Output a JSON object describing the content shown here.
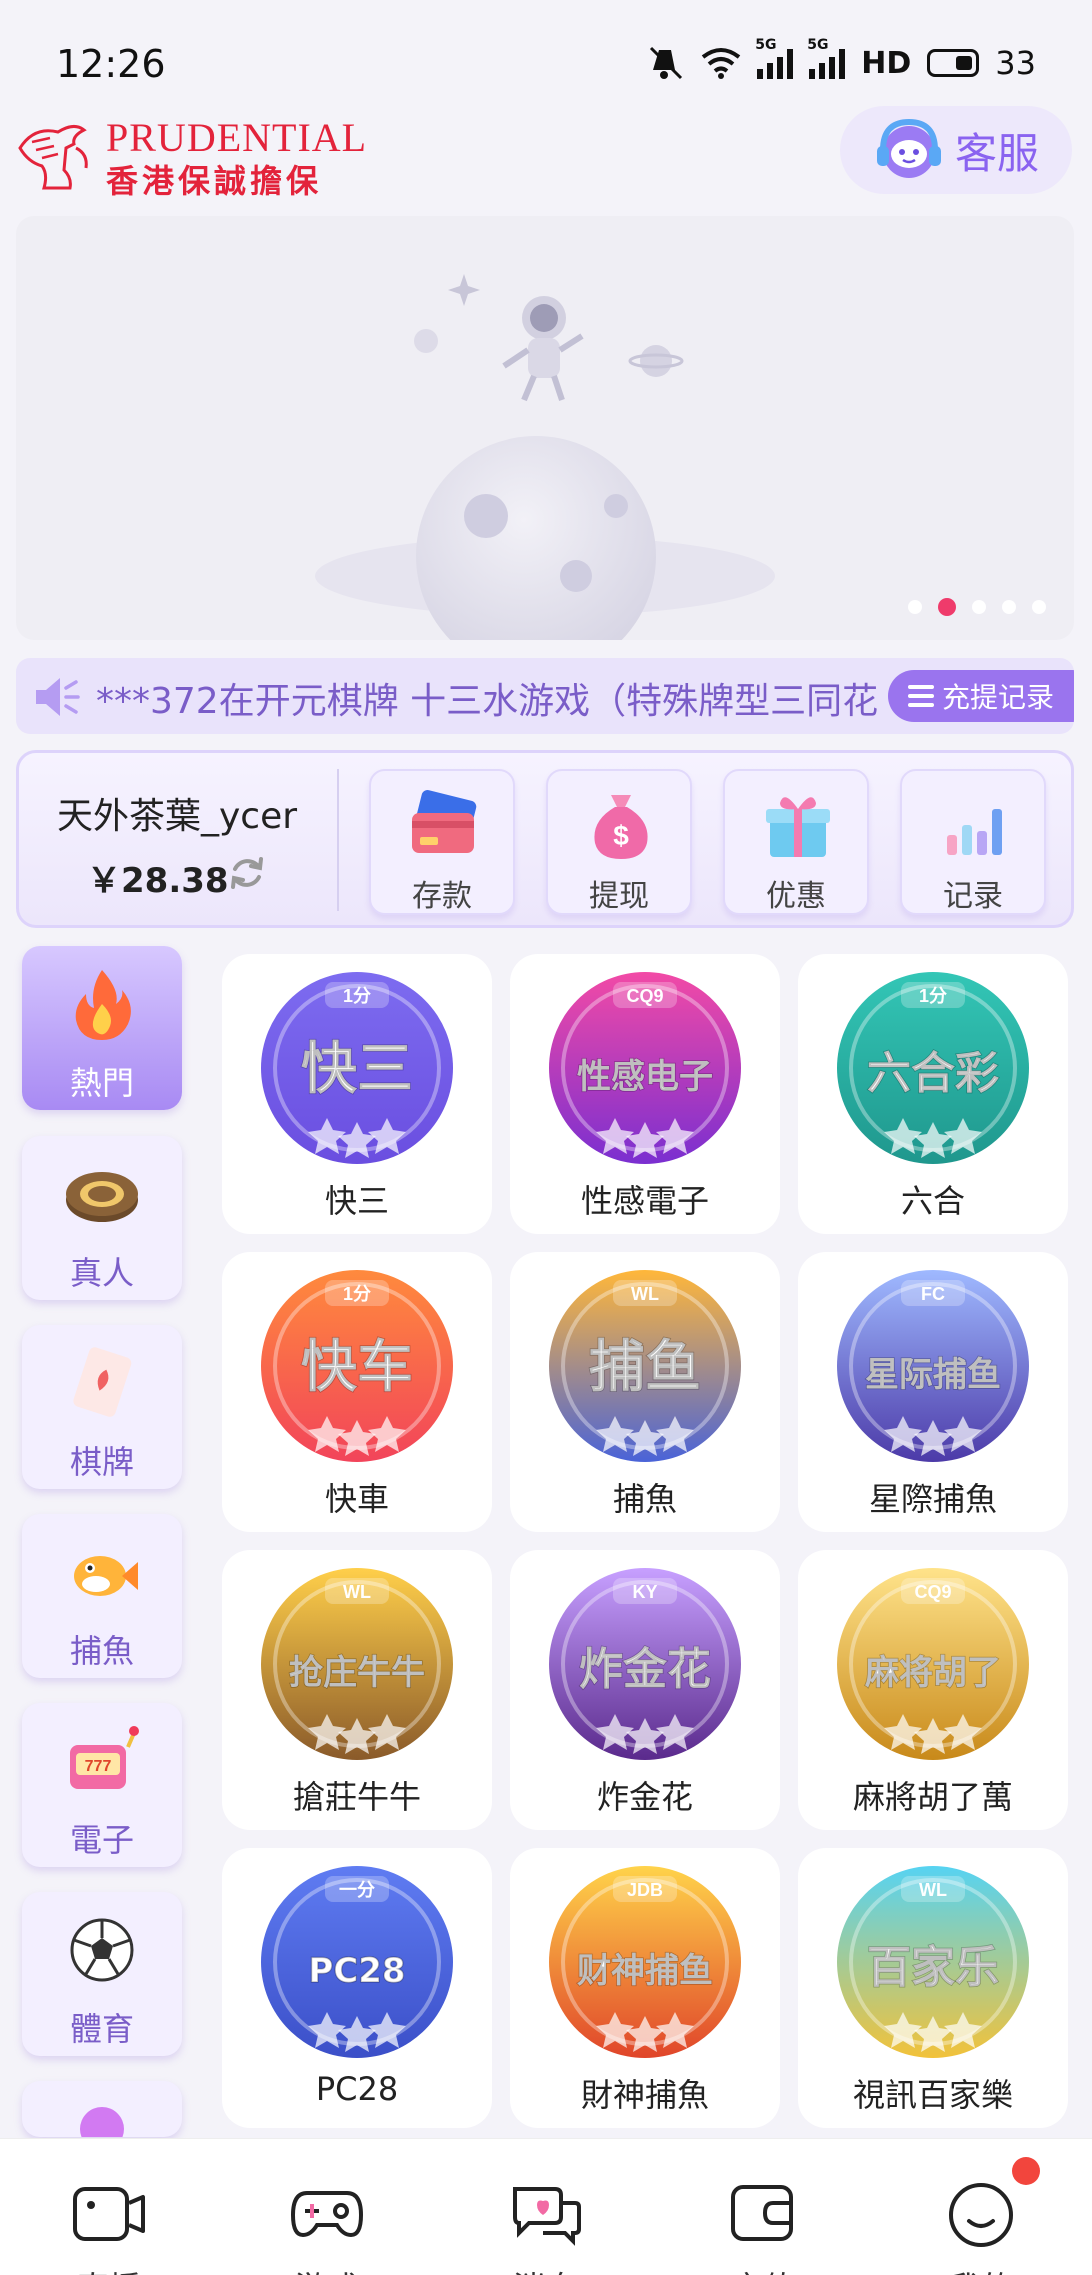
{
  "status": {
    "time": "12:26",
    "hd": "HD",
    "battery": "33",
    "sig_label": "5G"
  },
  "header": {
    "logo_en": "PRUDENTIAL",
    "logo_zh": "香港保誠擔保",
    "service_label": "客服"
  },
  "banner": {
    "dot_count": 5,
    "active_dot": 2
  },
  "marquee": {
    "text": "***372在开元棋牌 十三水游戏（特殊牌型三同花",
    "record_label": "充提记录"
  },
  "wallet": {
    "user_name": "天外茶葉_ycer",
    "balance": "￥28.38",
    "actions": [
      {
        "label": "存款",
        "icon": "card-icon"
      },
      {
        "label": "提现",
        "icon": "money-bag-icon"
      },
      {
        "label": "优惠",
        "icon": "gift-icon"
      },
      {
        "label": "记录",
        "icon": "bar-chart-icon"
      }
    ]
  },
  "categories": [
    {
      "label": "熱門",
      "icon": "flame-icon",
      "active": true
    },
    {
      "label": "真人",
      "icon": "chip-icon",
      "active": false
    },
    {
      "label": "棋牌",
      "icon": "playing-card-icon",
      "active": false
    },
    {
      "label": "捕魚",
      "icon": "fish-icon",
      "active": false
    },
    {
      "label": "電子",
      "icon": "slot-machine-icon",
      "active": false
    },
    {
      "label": "體育",
      "icon": "soccer-ball-icon",
      "active": false
    }
  ],
  "games": [
    {
      "label": "快三",
      "badge": "1分",
      "title": "快三",
      "colors": [
        "#7d6cf0",
        "#6a4ee0"
      ]
    },
    {
      "label": "性感電子",
      "badge": "CQ9",
      "title": "性感电子",
      "colors": [
        "#f24aa6",
        "#7a2fd0"
      ]
    },
    {
      "label": "六合",
      "badge": "1分",
      "title": "六合彩",
      "colors": [
        "#33c6b6",
        "#1f978d"
      ]
    },
    {
      "label": "快車",
      "badge": "1分",
      "title": "快车",
      "colors": [
        "#ff8a3d",
        "#f2445a"
      ]
    },
    {
      "label": "捕魚",
      "badge": "WL",
      "title": "捕鱼",
      "colors": [
        "#ffb73a",
        "#4a63d8"
      ]
    },
    {
      "label": "星際捕魚",
      "badge": "FC",
      "title": "星际捕鱼",
      "colors": [
        "#9fb9ff",
        "#4c3aa8"
      ]
    },
    {
      "label": "搶莊牛牛",
      "badge": "WL",
      "title": "抢庄牛牛",
      "colors": [
        "#ffcf4a",
        "#8a5a2a"
      ]
    },
    {
      "label": "炸金花",
      "badge": "KY",
      "title": "炸金花",
      "colors": [
        "#c7a0ff",
        "#5a2a8c"
      ]
    },
    {
      "label": "麻將胡了萬",
      "badge": "CQ9",
      "title": "麻将胡了",
      "colors": [
        "#ffe38a",
        "#c8891a"
      ]
    },
    {
      "label": "PC28",
      "badge": "一分",
      "title": "PC28",
      "colors": [
        "#5f7cf2",
        "#3b4fc8"
      ]
    },
    {
      "label": "財神捕魚",
      "badge": "JDB",
      "title": "财神捕鱼",
      "colors": [
        "#ffd34a",
        "#e0452a"
      ]
    },
    {
      "label": "視訊百家樂",
      "badge": "WL",
      "title": "百家乐",
      "colors": [
        "#56d3f2",
        "#f2c23a"
      ]
    }
  ],
  "bottom_nav": [
    {
      "label": "直播",
      "icon": "live-tv-icon"
    },
    {
      "label": "游戏",
      "icon": "gamepad-icon"
    },
    {
      "label": "消息",
      "icon": "chat-icon"
    },
    {
      "label": "充值",
      "icon": "wallet-icon"
    },
    {
      "label": "我的",
      "icon": "smiley-icon",
      "has_badge": true
    }
  ],
  "colors": {
    "accent": "#9a74ee",
    "brand_red": "#e3233b",
    "badge_red": "#f2453d"
  }
}
